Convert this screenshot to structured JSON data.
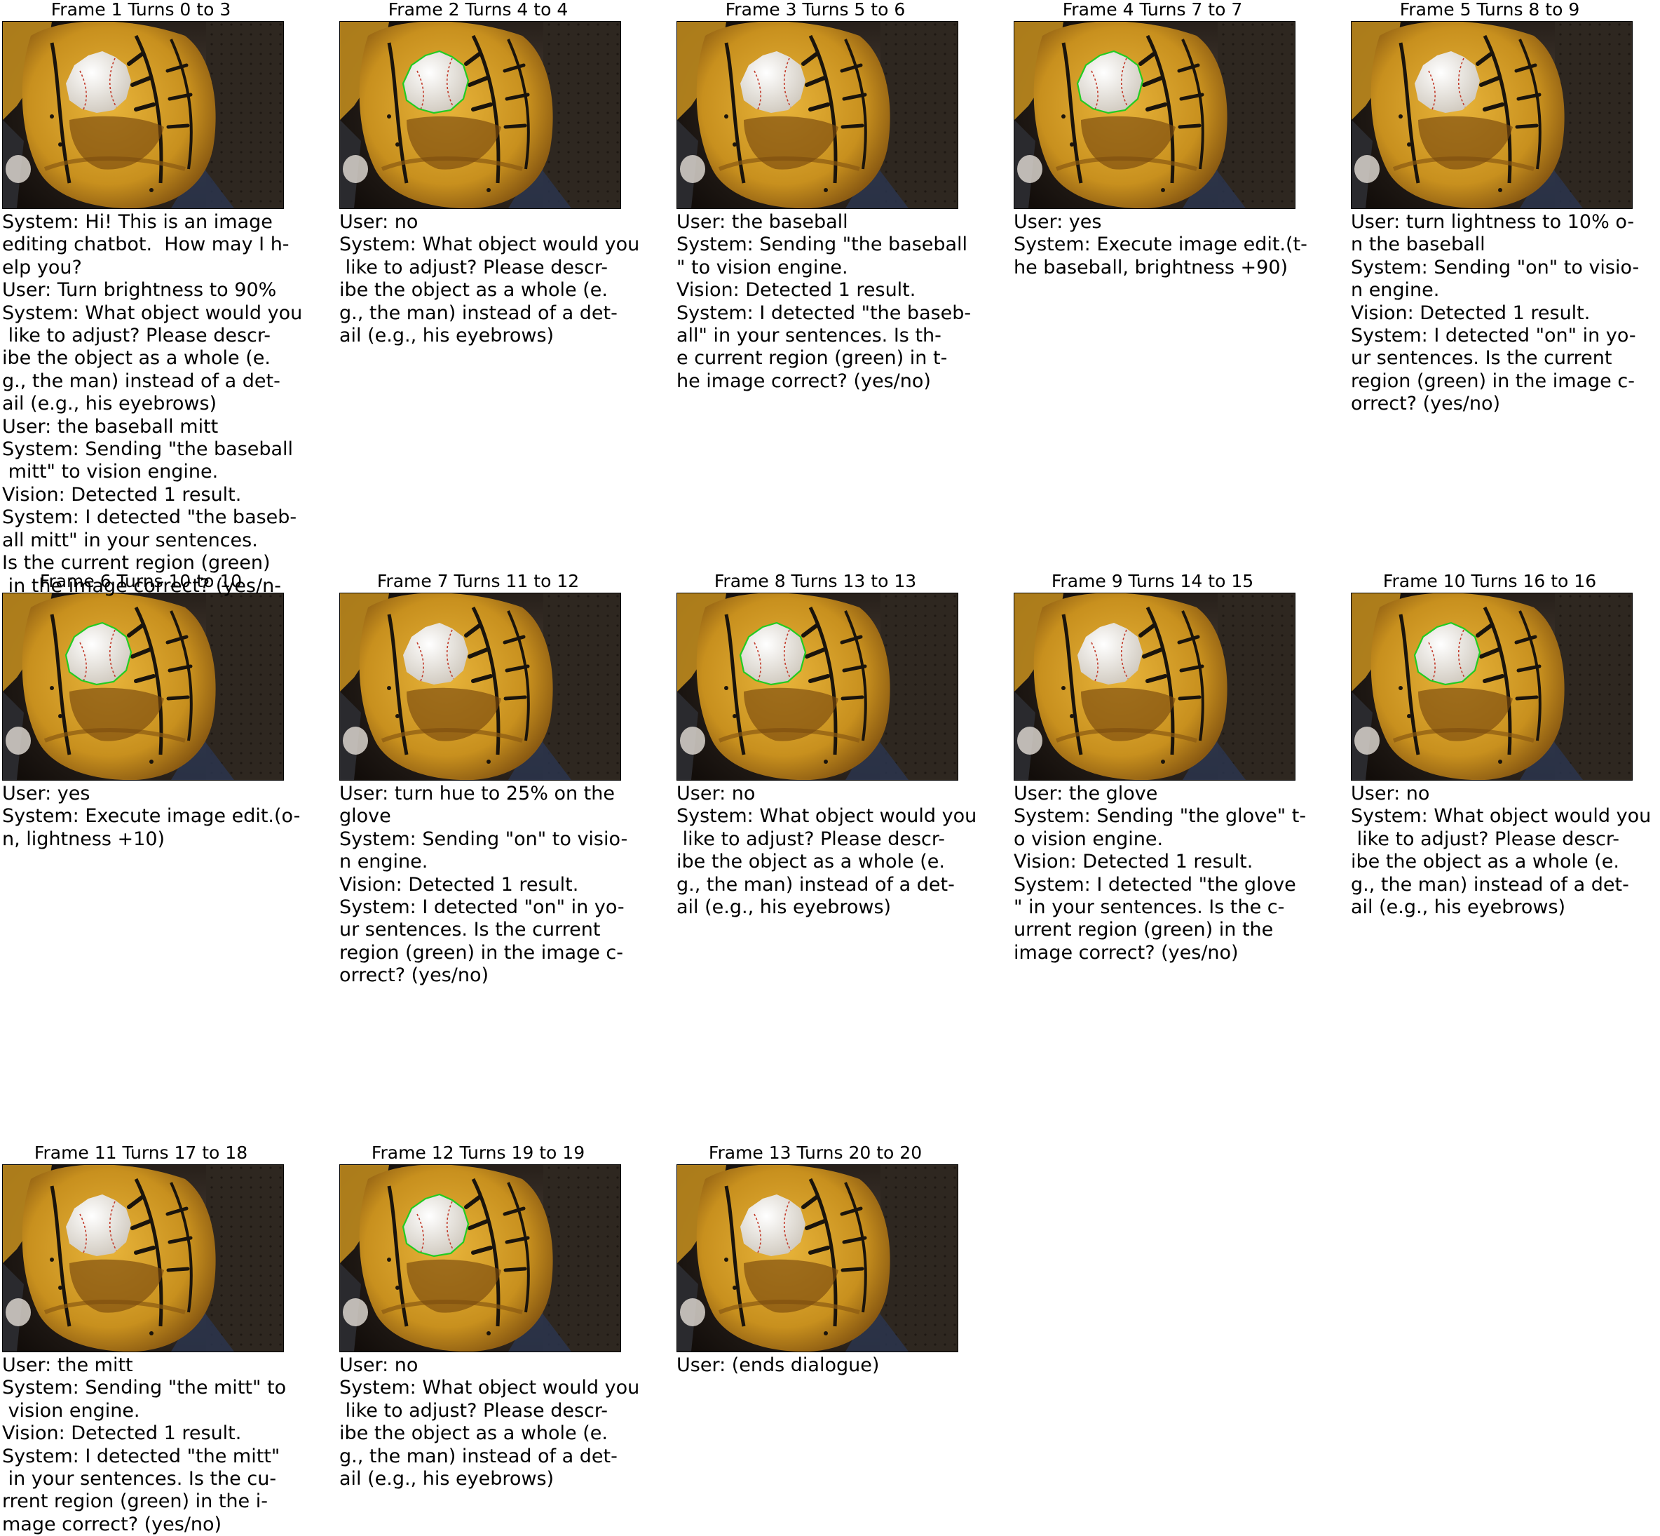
{
  "frames": [
    {
      "title": "Frame 1 Turns 0 to 3",
      "highlight": "none",
      "lines": [
        "System: Hi! This is an image",
        "editing chatbot.  How may I h-",
        "elp you?",
        "User: Turn brightness to 90%",
        "System: What object would you",
        " like to adjust? Please descr-",
        "ibe the object as a whole (e.",
        "g., the man) instead of a det-",
        "ail (e.g., his eyebrows)",
        "User: the baseball mitt",
        "System: Sending \"the baseball",
        " mitt\" to vision engine.",
        "Vision: Detected 1 result.",
        "System: I detected \"the baseb-",
        "all mitt\" in your sentences.",
        "Is the current region (green)",
        " in the image correct? (yes/n-"
      ]
    },
    {
      "title": "Frame 2 Turns 4 to 4",
      "highlight": "ball",
      "lines": [
        "User: no",
        "System: What object would you",
        " like to adjust? Please descr-",
        "ibe the object as a whole (e.",
        "g., the man) instead of a det-",
        "ail (e.g., his eyebrows)"
      ]
    },
    {
      "title": "Frame 3 Turns 5 to 6",
      "highlight": "none",
      "lines": [
        "User: the baseball",
        "System: Sending \"the baseball",
        "\" to vision engine.",
        "Vision: Detected 1 result.",
        "System: I detected \"the baseb-",
        "all\" in your sentences. Is th-",
        "e current region (green) in t-",
        "he image correct? (yes/no)"
      ]
    },
    {
      "title": "Frame 4 Turns 7 to 7",
      "highlight": "ball",
      "lines": [
        "User: yes",
        "System: Execute image edit.(t-",
        "he baseball, brightness +90)"
      ]
    },
    {
      "title": "Frame 5 Turns 8 to 9",
      "highlight": "none",
      "lines": [
        "User: turn lightness to 10% o-",
        "n the baseball",
        "System: Sending \"on\" to visio-",
        "n engine.",
        "Vision: Detected 1 result.",
        "System: I detected \"on\" in yo-",
        "ur sentences. Is the current",
        "region (green) in the image c-",
        "orrect? (yes/no)"
      ]
    },
    {
      "title": "Frame 6 Turns 10 to 10",
      "highlight": "ball",
      "lines": [
        "User: yes",
        "System: Execute image edit.(o-",
        "n, lightness +10)"
      ]
    },
    {
      "title": "Frame 7 Turns 11 to 12",
      "highlight": "none",
      "lines": [
        "User: turn hue to 25% on the",
        "glove",
        "System: Sending \"on\" to visio-",
        "n engine.",
        "Vision: Detected 1 result.",
        "System: I detected \"on\" in yo-",
        "ur sentences. Is the current",
        "region (green) in the image c-",
        "orrect? (yes/no)"
      ]
    },
    {
      "title": "Frame 8 Turns 13 to 13",
      "highlight": "ball",
      "lines": [
        "User: no",
        "System: What object would you",
        " like to adjust? Please descr-",
        "ibe the object as a whole (e.",
        "g., the man) instead of a det-",
        "ail (e.g., his eyebrows)"
      ]
    },
    {
      "title": "Frame 9 Turns 14 to 15",
      "highlight": "none",
      "lines": [
        "User: the glove",
        "System: Sending \"the glove\" t-",
        "o vision engine.",
        "Vision: Detected 1 result.",
        "System: I detected \"the glove",
        "\" in your sentences. Is the c-",
        "urrent region (green) in the",
        "image correct? (yes/no)"
      ]
    },
    {
      "title": "Frame 10 Turns 16 to 16",
      "highlight": "ball",
      "lines": [
        "User: no",
        "System: What object would you",
        " like to adjust? Please descr-",
        "ibe the object as a whole (e.",
        "g., the man) instead of a det-",
        "ail (e.g., his eyebrows)"
      ]
    },
    {
      "title": "Frame 11 Turns 17 to 18",
      "highlight": "none",
      "lines": [
        "User: the mitt",
        "System: Sending \"the mitt\" to",
        " vision engine.",
        "Vision: Detected 1 result.",
        "System: I detected \"the mitt\"",
        " in your sentences. Is the cu-",
        "rrent region (green) in the i-",
        "mage correct? (yes/no)"
      ]
    },
    {
      "title": "Frame 12 Turns 19 to 19",
      "highlight": "ball",
      "lines": [
        "User: no",
        "System: What object would you",
        " like to adjust? Please descr-",
        "ibe the object as a whole (e.",
        "g., the man) instead of a det-",
        "ail (e.g., his eyebrows)"
      ]
    },
    {
      "title": "Frame 13 Turns 20 to 20",
      "highlight": "none",
      "lines": [
        "User: (ends dialogue)"
      ]
    }
  ],
  "colors": {
    "highlight": "#22cc22",
    "glove": "#e8b43a",
    "glove_shadow": "#8a5a12",
    "lace": "#1a140c",
    "ball": "#f4f0ea",
    "stitch": "#c23a2a",
    "background": "#3a3028"
  }
}
